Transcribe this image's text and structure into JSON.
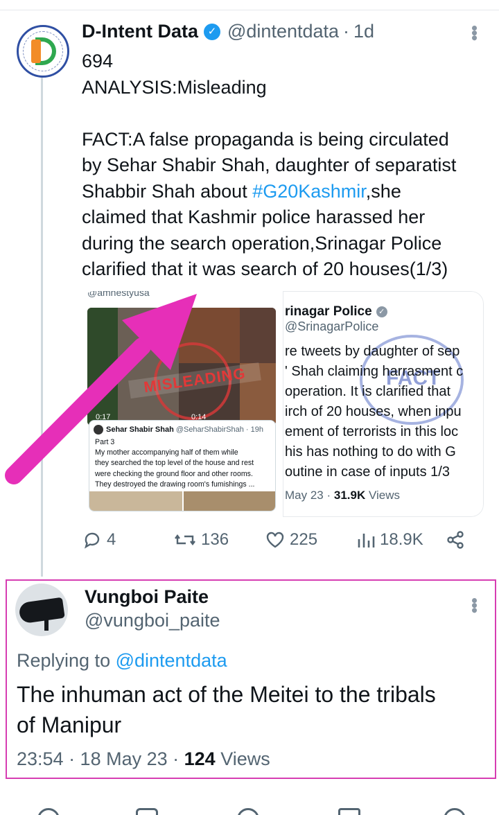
{
  "tweet": {
    "author_name": "D-Intent Data",
    "handle": "@dintentdata",
    "separator": "·",
    "time": "1d",
    "lines": [
      "694",
      "ANALYSIS:Misleading",
      "",
      "FACT:A false propaganda is being circulated",
      "by Sehar Shabir Shah, daughter of separatist"
    ],
    "line6_prefix": "Shabbir Shah about ",
    "hashtag": "#G20Kashmir",
    "line6_suffix": ",she",
    "lines_after": [
      "claimed that Kashmir police harassed her",
      "during the search operation,Srinagar Police",
      "clarified that it was search of 20 houses(1/3)"
    ],
    "media_left": {
      "tag": "@amnestyusa",
      "stamp_text": "MISLEADING",
      "ts1": "0:17",
      "ts2": "0:14",
      "quote_name": "Sehar Shabir Shah",
      "quote_handle": "@SeharShabirShah · 19h",
      "quote_lines": [
        "Part 3",
        "My mother accompanying half of them while",
        "they searched the top level of the house and rest",
        "were checking the ground floor and other rooms.",
        "They destroyed  the drawing room's fumishings ..."
      ]
    },
    "media_right": {
      "name": "rinagar Police",
      "handle": "@SrinagarPolice",
      "lines": [
        "re tweets by daughter of sep",
        "' Shah claiming harrasment c",
        "operation. It is clarified that",
        "irch of 20 houses, when inpu",
        "ement of terrorists in this loc",
        "his has nothing to do with G",
        "outine in case of inputs 1/3"
      ],
      "stamp_text": "FACT",
      "date": "May 23 · ",
      "views_count": "31.9K",
      "views_label": " Views"
    },
    "actions": {
      "replies": "4",
      "retweets": "136",
      "likes": "225",
      "views": "18.9K"
    }
  },
  "reply": {
    "author_name": "Vungboi Paite",
    "handle": "@vungboi_paite",
    "replying_prefix": "Replying to ",
    "replying_to": "@dintentdata",
    "text_lines": [
      "The inhuman act of the Meitei to the tribals",
      "of Manipur"
    ],
    "meta_prefix": "23:54 · 18 May 23 · ",
    "views_count": "124",
    "views_label": " Views"
  },
  "colors": {
    "accent": "#1d9bf0",
    "highlight_border": "#d63db2",
    "arrow": "#e62fb8",
    "muted": "#536471"
  }
}
